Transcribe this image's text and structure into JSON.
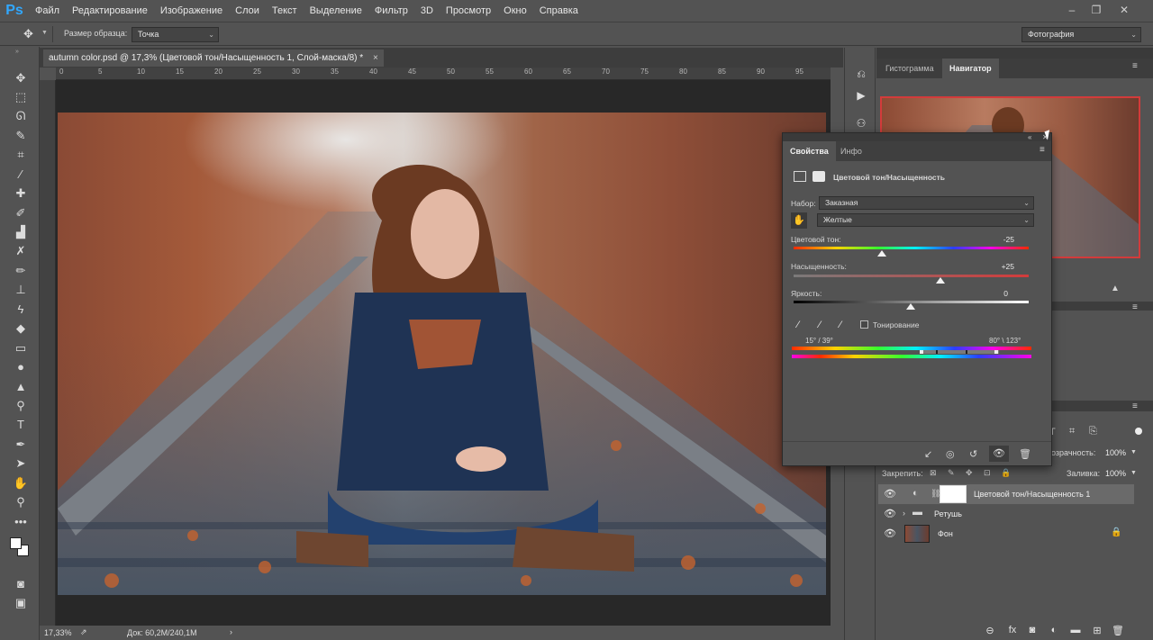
{
  "app": {
    "logo": "Ps",
    "menu": [
      "Файл",
      "Редактирование",
      "Изображение",
      "Слои",
      "Текст",
      "Выделение",
      "Фильтр",
      "3D",
      "Просмотр",
      "Окно",
      "Справка"
    ]
  },
  "options_bar": {
    "sample_size_label": "Размер образца:",
    "sample_size_value": "Точка",
    "workspace": "Фотография"
  },
  "document": {
    "tab_title": "autumn color.psd @ 17,3% (Цветовой тон/Насыщенность 1, Слой-маска/8) *",
    "ruler_ticks": [
      "0",
      "5",
      "10",
      "15",
      "20",
      "25",
      "30",
      "35",
      "40",
      "45",
      "50",
      "55",
      "60",
      "65",
      "70",
      "75",
      "80",
      "85",
      "90",
      "95"
    ],
    "zoom": "17,33%",
    "doc_size": "Док: 60,2M/240,1M"
  },
  "top_panel": {
    "tabs": [
      "Гистограмма",
      "Навигатор"
    ]
  },
  "properties": {
    "tabs": [
      "Свойства",
      "Инфо"
    ],
    "title": "Цветовой тон/Насыщенность",
    "preset_label": "Набор:",
    "preset_value": "Заказная",
    "channel_value": "Желтые",
    "hue_label": "Цветовой тон:",
    "hue_value": "-25",
    "saturation_label": "Насыщенность:",
    "saturation_value": "+25",
    "lightness_label": "Яркость:",
    "lightness_value": "0",
    "colorize_label": "Тонирование",
    "range_left": "15° / 39°",
    "range_right": "80° \\ 123°"
  },
  "layers": {
    "opacity_label": "розрачность:",
    "opacity_value": "100%",
    "lock_label": "Закрепить:",
    "fill_label": "Заливка:",
    "fill_value": "100%",
    "items": [
      {
        "name": "Цветовой тон/Насыщенность 1"
      },
      {
        "name": "Ретушь"
      },
      {
        "name": "Фон"
      }
    ]
  },
  "colors": {
    "accent_red": "#d33b3b",
    "ps_blue": "#31a8ff"
  }
}
